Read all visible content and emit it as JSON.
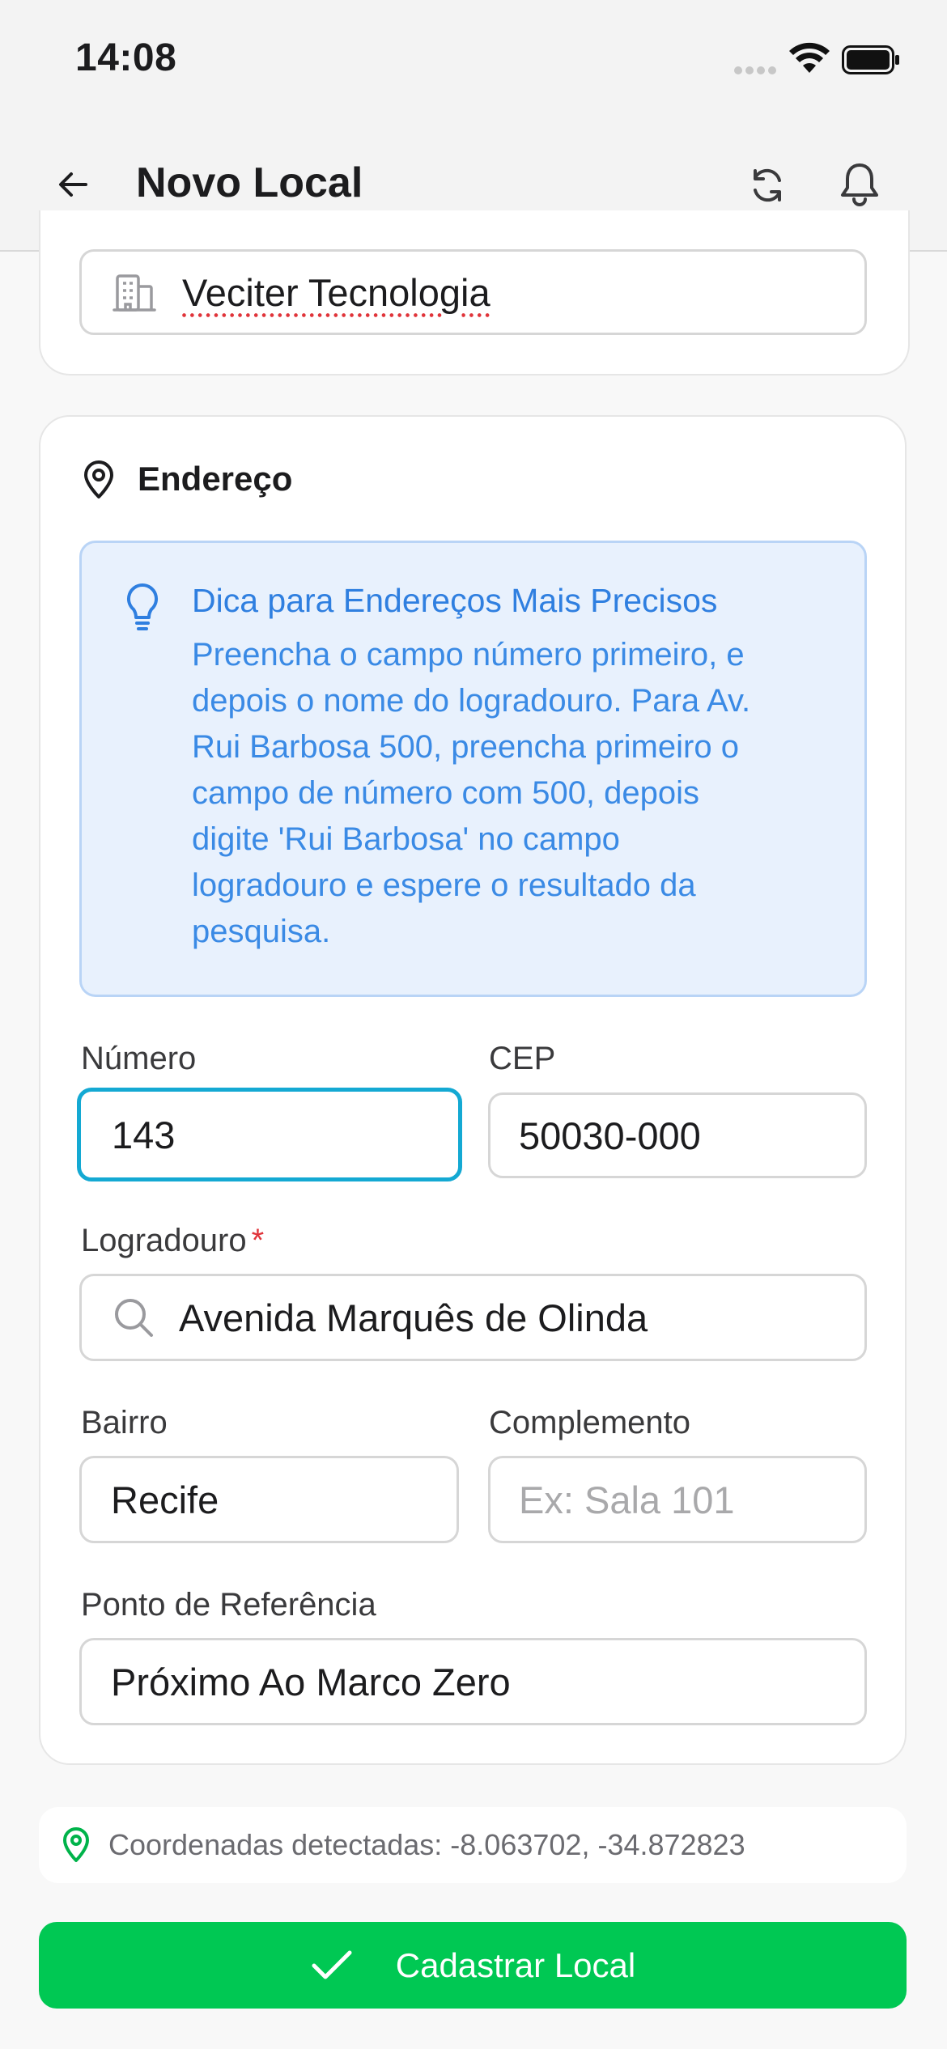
{
  "status_bar": {
    "time": "14:08"
  },
  "header": {
    "title": "Novo Local",
    "back_icon": "arrow-left-icon",
    "refresh_icon": "refresh-icon",
    "notifications_icon": "bell-icon"
  },
  "company": {
    "value": "Veciter Tecnologia",
    "icon": "building-icon"
  },
  "address": {
    "section_title": "Endereço",
    "tip": {
      "title": "Dica para Endereços Mais Precisos",
      "lines": [
        "Preencha o campo número primeiro, e",
        "depois o nome do logradouro. Para Av.",
        "Rui Barbosa 500, preencha primeiro o",
        "campo de número com 500, depois",
        "digite 'Rui Barbosa' no campo",
        "logradouro e espere o resultado da",
        "pesquisa."
      ]
    },
    "numero": {
      "label": "Número",
      "value": "143"
    },
    "cep": {
      "label": "CEP",
      "value": "50030-000"
    },
    "logradouro": {
      "label": "Logradouro",
      "required_mark": "*",
      "value": "Avenida Marquês de Olinda"
    },
    "bairro": {
      "label": "Bairro",
      "value": "Recife"
    },
    "complemento": {
      "label": "Complemento",
      "placeholder": "Ex: Sala 101"
    },
    "referencia": {
      "label": "Ponto de Referência",
      "value": "Próximo Ao Marco Zero"
    }
  },
  "coordinates": {
    "text": "Coordenadas detectadas: -8.063702, -34.872823"
  },
  "submit": {
    "label": "Cadastrar Local"
  },
  "colors": {
    "accent_green": "#00c853",
    "focus_blue": "#14a9d3",
    "tip_blue": "#2f7fe0",
    "required_red": "#e0343a"
  }
}
